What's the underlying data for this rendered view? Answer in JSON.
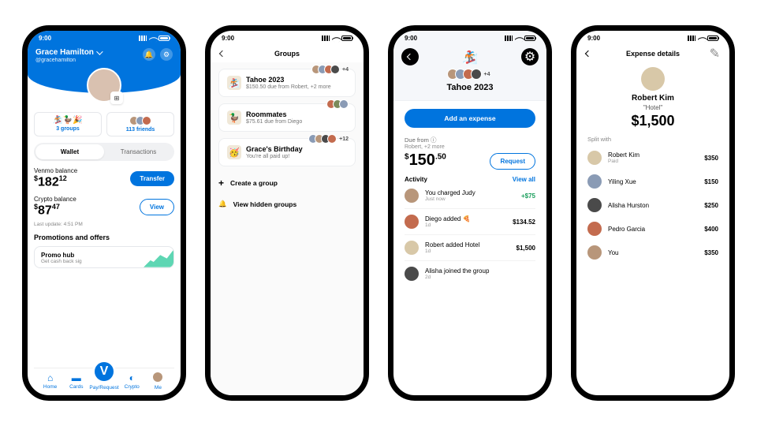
{
  "status": {
    "time": "9:00"
  },
  "p1": {
    "name": "Grace Hamilton",
    "handle": "@gracehamilton",
    "groups_label": "3 groups",
    "friends_label": "113 friends",
    "tabs": {
      "wallet": "Wallet",
      "transactions": "Transactions"
    },
    "venmo": {
      "title": "Venmo balance",
      "dollars": "182",
      "cents": "12",
      "btn": "Transfer"
    },
    "crypto": {
      "title": "Crypto balance",
      "dollars": "87",
      "cents": "47",
      "btn": "View"
    },
    "last_update": "Last update: 4:51 PM",
    "promo_title": "Promotions and offers",
    "promo_card": {
      "title": "Promo hub",
      "sub": "Get cash back sig"
    },
    "tabs_bar": {
      "home": "Home",
      "cards": "Cards",
      "pay": "Pay/Request",
      "crypto": "Crypto",
      "me": "Me"
    }
  },
  "p2": {
    "title": "Groups",
    "groups": [
      {
        "name": "Tahoe 2023",
        "sub": "$150.50 due from Robert, +2 more",
        "extra": "+4"
      },
      {
        "name": "Roommates",
        "sub": "$75.61 due from Diego"
      },
      {
        "name": "Grace's Birthday",
        "sub": "You're all paid up!",
        "extra": "+12"
      }
    ],
    "create": "Create a group",
    "hidden": "View hidden groups"
  },
  "p3": {
    "title": "Tahoe 2023",
    "extra": "+4",
    "add": "Add an expense",
    "due_from": "Due from",
    "due_sub": "Robert, +2 more",
    "amount_d": "150",
    "amount_c": "50",
    "request": "Request",
    "activity": "Activity",
    "view_all": "View all",
    "items": [
      {
        "t": "You charged Judy",
        "s": "Just now",
        "a": "+$75",
        "pos": true
      },
      {
        "t": "Diego added 🍕",
        "s": "1d",
        "a": "$134.52"
      },
      {
        "t": "Robert added Hotel",
        "s": "1d",
        "a": "$1,500"
      },
      {
        "t": "Alisha joined the group",
        "s": "2d",
        "a": ""
      }
    ]
  },
  "p4": {
    "title": "Expense details",
    "name": "Robert Kim",
    "item": "\"Hotel\"",
    "total": "$1,500",
    "split_label": "Split with",
    "rows": [
      {
        "n": "Robert Kim",
        "s": "Paid",
        "a": "$350"
      },
      {
        "n": "Yiling Xue",
        "s": "",
        "a": "$150"
      },
      {
        "n": "Alisha Hurston",
        "s": "",
        "a": "$250"
      },
      {
        "n": "Pedro Garcia",
        "s": "",
        "a": "$400"
      },
      {
        "n": "You",
        "s": "",
        "a": "$350"
      }
    ]
  }
}
